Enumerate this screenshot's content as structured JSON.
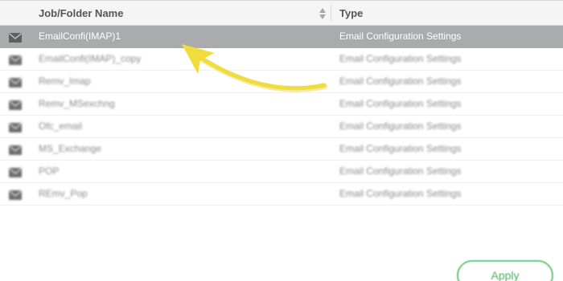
{
  "table": {
    "columns": {
      "name": "Job/Folder Name",
      "type": "Type"
    },
    "icons": {
      "sort": "sort-arrows-icon",
      "row": "envelope-icon"
    },
    "rows": [
      {
        "name": "EmailConfi(IMAP)1",
        "type": "Email Configuration Settings",
        "selected": true
      },
      {
        "name": "EmailConfi(IMAP)_copy",
        "type": "Email Configuration Settings",
        "selected": false
      },
      {
        "name": "Remv_Imap",
        "type": "Email Configuration Settings",
        "selected": false
      },
      {
        "name": "Remv_MSexchng",
        "type": "Email Configuration Settings",
        "selected": false
      },
      {
        "name": "Ofc_email",
        "type": "Email Configuration Settings",
        "selected": false
      },
      {
        "name": "MS_Exchange",
        "type": "Email Configuration Settings",
        "selected": false
      },
      {
        "name": "POP",
        "type": "Email Configuration Settings",
        "selected": false
      },
      {
        "name": "REmv_Pop",
        "type": "Email Configuration Settings",
        "selected": false
      }
    ]
  },
  "footer": {
    "apply_label": "Apply"
  },
  "colors": {
    "selected_row": "#a9abad",
    "annotation_arrow": "#f0dc3c",
    "apply_border": "#6cc57a"
  }
}
